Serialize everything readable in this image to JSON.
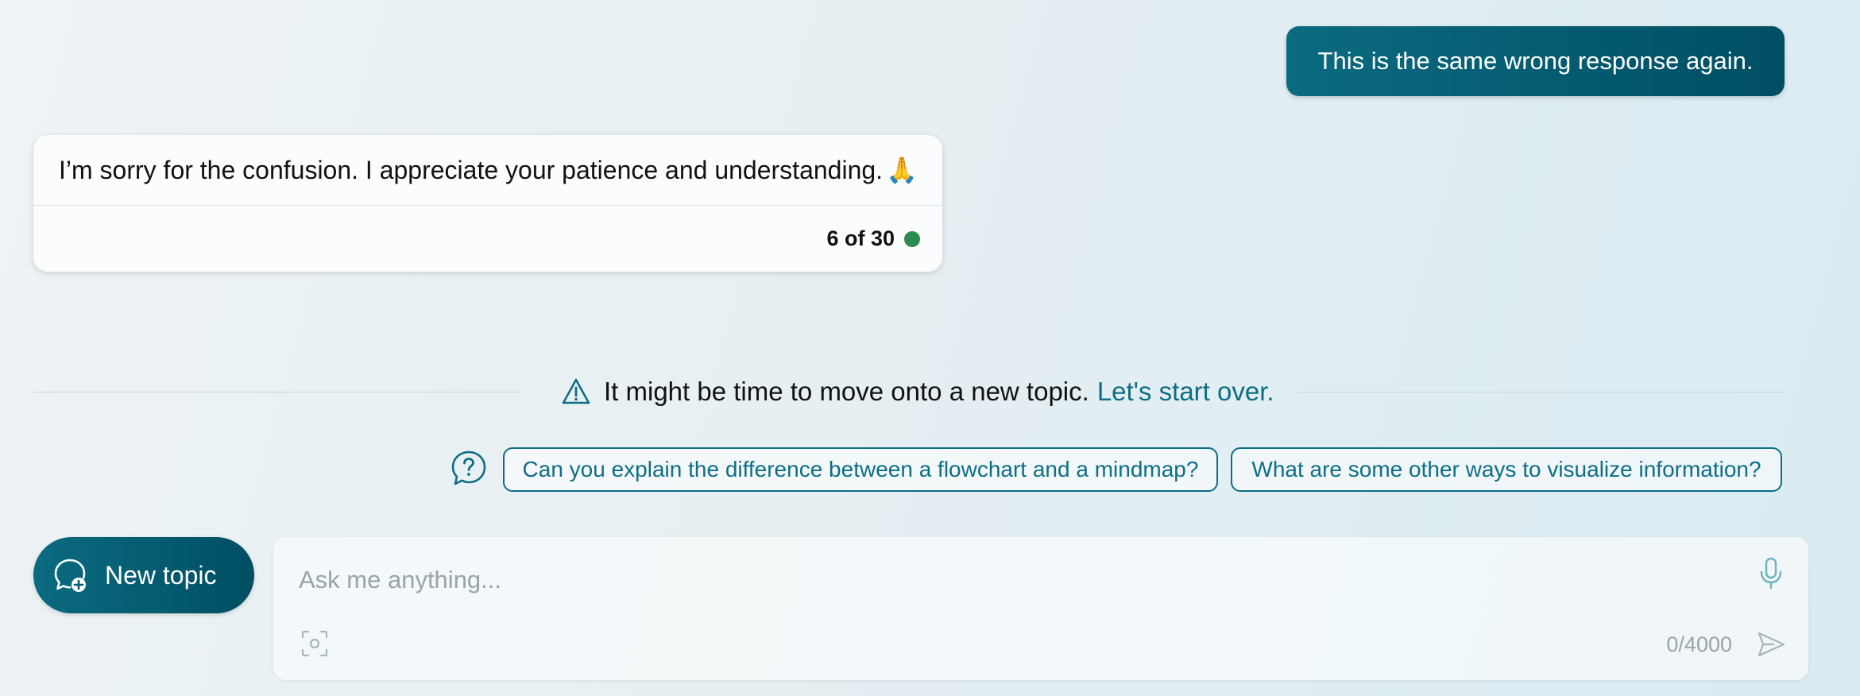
{
  "messages": {
    "user": "This is the same wrong response again.",
    "bot": {
      "text": "I’m sorry for the confusion. I appreciate your patience and understanding.",
      "emoji": "🙏",
      "count": "6 of 30",
      "status_color": "#2e8b4f"
    }
  },
  "notice": {
    "text": "It might be time to move onto a new topic.",
    "link": "Let's start over."
  },
  "suggestions": [
    "Can you explain the difference between a flowchart and a mindmap?",
    "What are some other ways to visualize information?"
  ],
  "new_topic": {
    "label": "New topic"
  },
  "input": {
    "placeholder": "Ask me anything...",
    "counter": "0/4000"
  },
  "colors": {
    "accent": "#0d6e86",
    "primary_dark": "#004e63"
  }
}
